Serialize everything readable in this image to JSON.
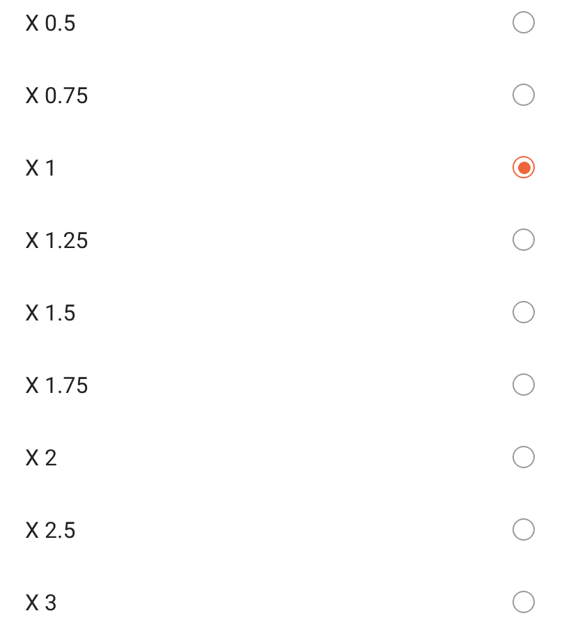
{
  "options": [
    {
      "label": "X 0.5",
      "selected": false
    },
    {
      "label": "X 0.75",
      "selected": false
    },
    {
      "label": "X 1",
      "selected": true
    },
    {
      "label": "X 1.25",
      "selected": false
    },
    {
      "label": "X 1.5",
      "selected": false
    },
    {
      "label": "X 1.75",
      "selected": false
    },
    {
      "label": "X 2",
      "selected": false
    },
    {
      "label": "X 2.5",
      "selected": false
    },
    {
      "label": "X 3",
      "selected": false
    }
  ]
}
